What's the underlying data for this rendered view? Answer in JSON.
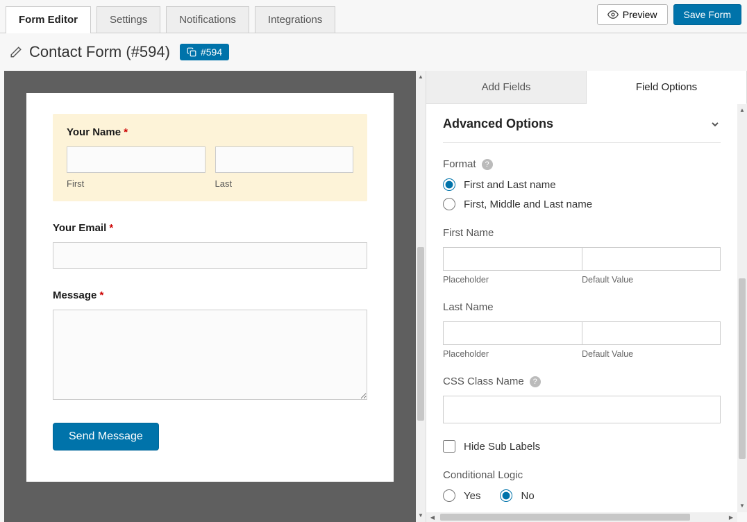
{
  "topbar": {
    "tabs": [
      "Form Editor",
      "Settings",
      "Notifications",
      "Integrations"
    ],
    "preview_label": "Preview",
    "save_label": "Save Form"
  },
  "title": {
    "text": "Contact Form (#594)",
    "badge": "#594"
  },
  "form": {
    "name_field": {
      "label": "Your Name",
      "sub_first": "First",
      "sub_last": "Last"
    },
    "email_field": {
      "label": "Your Email"
    },
    "message_field": {
      "label": "Message"
    },
    "submit_label": "Send Message"
  },
  "sidebar": {
    "tab_add": "Add Fields",
    "tab_options": "Field Options",
    "section": "Advanced Options",
    "format": {
      "label": "Format",
      "opt1": "First and Last name",
      "opt2": "First, Middle and Last name"
    },
    "first_name": {
      "label": "First Name",
      "placeholder": "Placeholder",
      "default": "Default Value"
    },
    "last_name": {
      "label": "Last Name",
      "placeholder": "Placeholder",
      "default": "Default Value"
    },
    "css": {
      "label": "CSS Class Name"
    },
    "hide_sub": "Hide Sub Labels",
    "logic": {
      "label": "Conditional Logic",
      "yes": "Yes",
      "no": "No"
    }
  }
}
